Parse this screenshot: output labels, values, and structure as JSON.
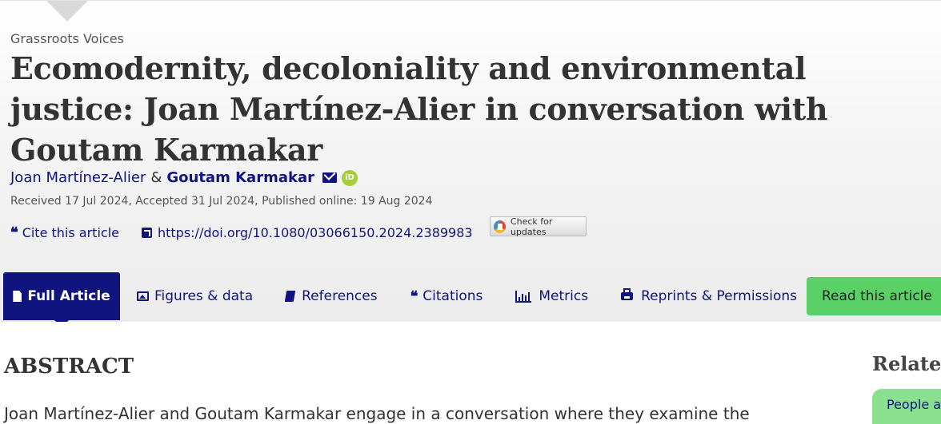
{
  "journal": "Grassroots Voices",
  "title": "Ecomodernity, decoloniality and environmental justice: Joan Martínez-Alier in conversation with Goutam Karmakar",
  "authors": {
    "author1": "Joan Martínez-Alier",
    "separator": "&",
    "author2": "Goutam Karmakar",
    "orcid_label": "iD"
  },
  "dates": "Received 17 Jul 2024, Accepted 31 Jul 2024, Published online: 19 Aug 2024",
  "actions": {
    "cite_icon": "❝",
    "cite": "Cite this article",
    "doi": "https://doi.org/10.1080/03066150.2024.2389983",
    "check_updates": "Check for updates"
  },
  "tabs": [
    {
      "label": "Full Article",
      "icon": "document-icon"
    },
    {
      "label": "Figures & data",
      "icon": "image-icon"
    },
    {
      "label": "References",
      "icon": "book-icon"
    },
    {
      "label": "Citations",
      "icon": "quote-icon"
    },
    {
      "label": "Metrics",
      "icon": "bar-chart-icon"
    },
    {
      "label": "Reprints & Permissions",
      "icon": "print-icon"
    }
  ],
  "citations_icon": "❝",
  "read_button": "Read this article",
  "abstract": {
    "heading": "ABSTRACT",
    "text": "Joan Martínez-Alier and Goutam Karmakar engage in a conversation where they examine the"
  },
  "sidebar": {
    "related_heading": "Related",
    "people_tab": "People a"
  },
  "colors": {
    "brand": "#10147e",
    "read_button": "#5ad167",
    "orcid": "#a6ce39"
  }
}
